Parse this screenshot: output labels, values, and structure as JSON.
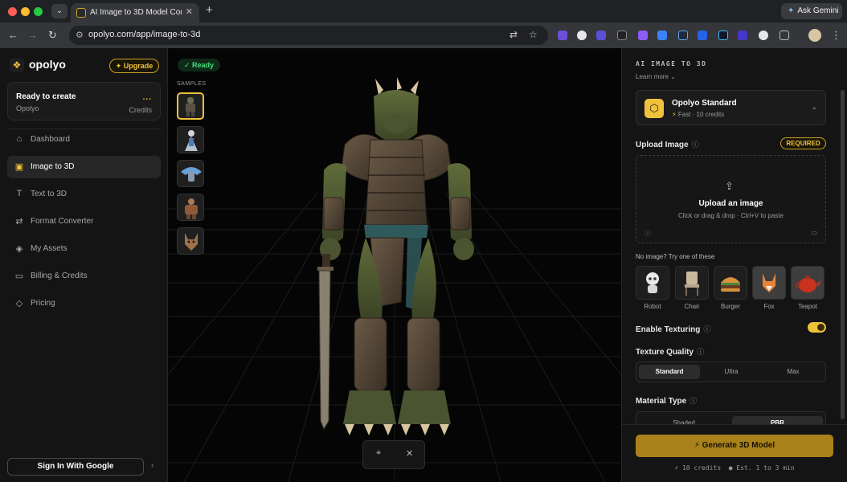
{
  "browser": {
    "tab_title": "AI Image to 3D Model Conver",
    "url": "opolyo.com/app/image-to-3d",
    "ask_gemini": "Ask Gemini",
    "ext_badge": "9"
  },
  "sidebar": {
    "brand": "opolyo",
    "upgrade_label": "✦ Upgrade",
    "status_card": {
      "title": "Ready to create",
      "user": "Opolyo",
      "credits_value": "...",
      "credits_label": "Credits"
    },
    "items": [
      {
        "label": "Dashboard",
        "icon": "home-icon"
      },
      {
        "label": "Image to 3D",
        "icon": "image-icon",
        "active": true
      },
      {
        "label": "Text to 3D",
        "icon": "text-icon"
      },
      {
        "label": "Format Converter",
        "icon": "convert-icon"
      },
      {
        "label": "My Assets",
        "icon": "layers-icon"
      },
      {
        "label": "Billing & Credits",
        "icon": "card-icon"
      },
      {
        "label": "Pricing",
        "icon": "tag-icon"
      }
    ],
    "signin_label": "Sign In With Google"
  },
  "viewport": {
    "status": "✓ Ready",
    "samples_label": "SAMPLES"
  },
  "panel": {
    "eyebrow": "AI IMAGE TO 3D",
    "learn_more": "Learn more ⌄",
    "model": {
      "name": "Opolyo Standard",
      "sub": "Fast · 10 credits"
    },
    "upload": {
      "title": "Upload Image",
      "required": "REQUIRED",
      "drop_title": "Upload an image",
      "drop_sub": "Click or drag & drop · Ctrl+V to paste"
    },
    "try_label": "No image? Try one of these",
    "try_items": [
      "Robot",
      "Chair",
      "Burger",
      "Fox",
      "Teapot"
    ],
    "texturing_label": "Enable Texturing",
    "texture_quality": {
      "title": "Texture Quality",
      "options": [
        "Standard",
        "Ultra",
        "Max"
      ]
    },
    "material_type": {
      "title": "Material Type",
      "options": [
        "Shaded",
        "PBR"
      ]
    },
    "generate_label": "Generate 3D Model",
    "footer_credits": "10 credits",
    "footer_est": "Est. 1 to 3 min"
  },
  "colors": {
    "accent": "#f0c23b",
    "ready": "#4ade80"
  }
}
